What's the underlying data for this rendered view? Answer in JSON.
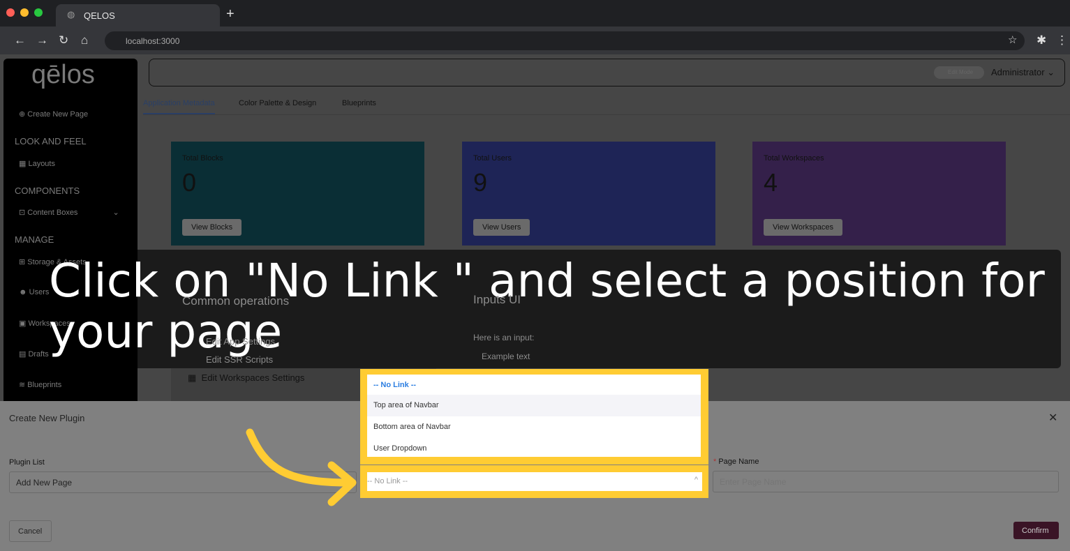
{
  "browser": {
    "tab_title": "QELOS",
    "url": "localhost:3000"
  },
  "sidebar": {
    "logo": "qēlos",
    "create": "Create New Page",
    "sections": [
      "LOOK AND FEEL",
      "COMPONENTS",
      "MANAGE"
    ],
    "items": [
      "Layouts",
      "Content Boxes",
      "Storage & Assets",
      "Users",
      "Workspaces",
      "Drafts",
      "Blueprints"
    ]
  },
  "header": {
    "edit_mode": "Edit Mode",
    "user": "Administrator"
  },
  "tabs": [
    "Application Metadata",
    "Color Palette & Design",
    "Blueprints"
  ],
  "cards": [
    {
      "title": "Total Blocks",
      "value": "0",
      "button": "View Blocks",
      "color": "#0a2e35"
    },
    {
      "title": "Total Users",
      "value": "9",
      "button": "View Users",
      "color": "#1e2456"
    },
    {
      "title": "Total Workspaces",
      "value": "4",
      "button": "View Workspaces",
      "color": "#34204a"
    }
  ],
  "lower": {
    "common": "Common operations",
    "inputs": "Inputs UI",
    "ops": [
      "Edit App Settings",
      "Edit SSR Scripts",
      "Edit Workspaces Settings"
    ],
    "input_label": "Here is an input:",
    "input_value": "Example text"
  },
  "banner": "Click on \"No Link \" and select a position for your page",
  "dialog": {
    "title": "Create New Plugin",
    "plugin_list_label": "Plugin List",
    "plugin_list_value": "Add New Page",
    "link_options": [
      "-- No Link --",
      "Top area of Navbar",
      "Bottom area of Navbar",
      "User Dropdown"
    ],
    "link_value": "-- No Link --",
    "page_name_label": "Page Name",
    "page_name_placeholder": "Enter Page Name",
    "cancel": "Cancel",
    "confirm": "Confirm"
  }
}
